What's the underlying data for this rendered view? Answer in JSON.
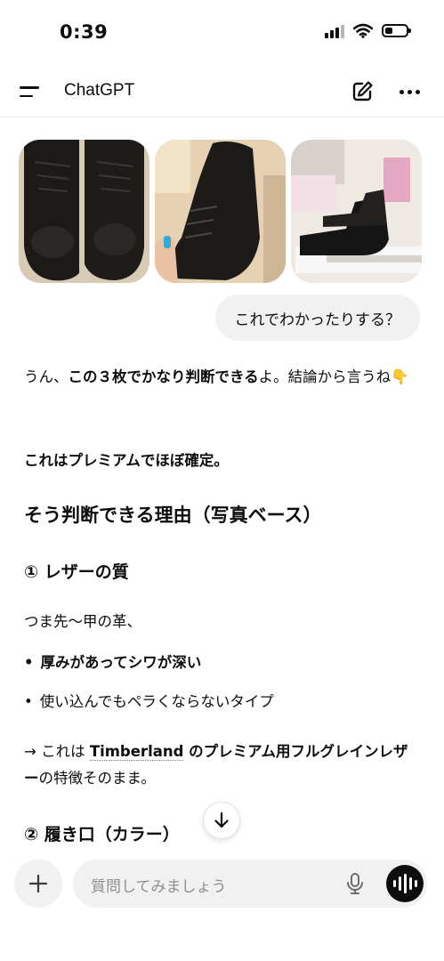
{
  "status_bar": {
    "time": "0:39",
    "signal_icon": "cellular-signal-icon",
    "wifi_icon": "wifi-icon",
    "battery_icon": "battery-icon",
    "battery_level": 0.35
  },
  "header": {
    "title": "ChatGPT",
    "menu_icon": "menu-icon",
    "new_chat_icon": "edit-icon",
    "more_icon": "more-icon"
  },
  "attachments": [
    {
      "alt_icon": "boots-photo-1"
    },
    {
      "alt_icon": "boots-photo-2"
    },
    {
      "alt_icon": "boots-photo-3"
    }
  ],
  "user_message": "これでわかったりする？",
  "assistant": {
    "p1_a": "うん、",
    "p1_b": "この３枚でかなり判断できる",
    "p1_c": "よ。結論から言うね",
    "p1_emoji": "👇",
    "p2": "これはプレミアムでほぼ確定。",
    "h2": "そう判断できる理由（写真ベース）",
    "h3_1": "① レザーの質",
    "p3": "つま先〜甲の革、",
    "bullet1": "厚みがあってシワが深い",
    "bullet2": "使い込んでもペラくならないタイプ",
    "p4_a": "→ これは ",
    "p4_link": "Timberland",
    "p4_b": " のプレミアム用フルグレインレザー",
    "p4_c": "の特徴そのまま。",
    "h3_2": "② 履き口（カラー）"
  },
  "composer": {
    "placeholder": "質問してみましょう",
    "plus_icon": "plus-icon",
    "mic_icon": "mic-icon",
    "voice_icon": "voice-mode-icon",
    "scroll_icon": "arrow-down-icon"
  }
}
